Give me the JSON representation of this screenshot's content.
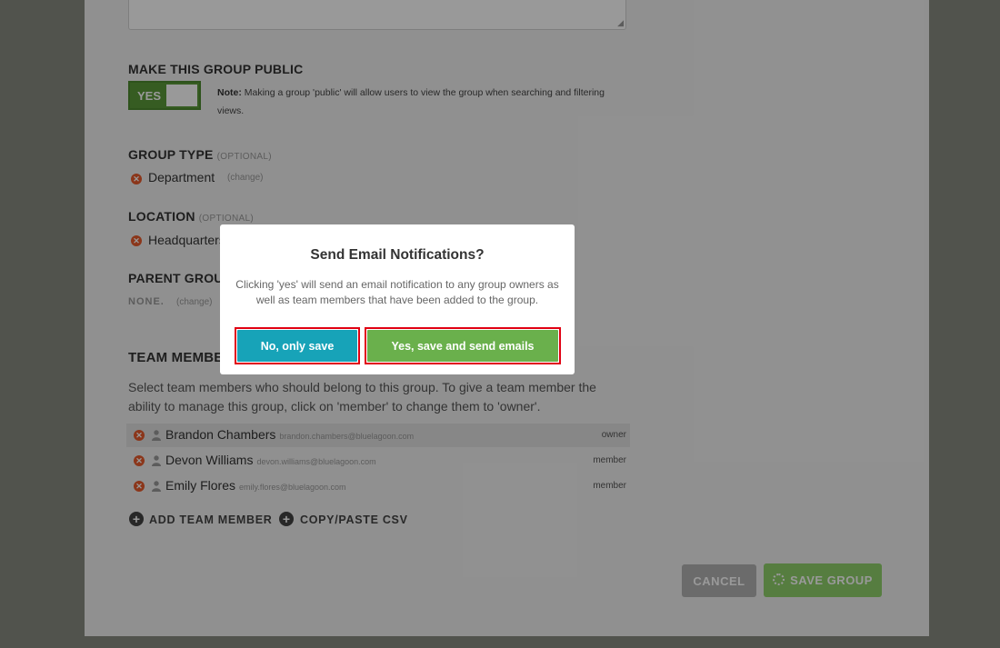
{
  "form": {
    "public": {
      "heading": "MAKE THIS GROUP PUBLIC",
      "toggle_label": "YES",
      "note_label": "Note:",
      "note_text": "Making a group 'public' will allow users to view the group when searching and filtering views."
    },
    "group_type": {
      "heading": "GROUP TYPE",
      "optional": "(OPTIONAL)",
      "value": "Department",
      "change": "(change)"
    },
    "location": {
      "heading": "LOCATION",
      "optional": "(OPTIONAL)",
      "value": "Headquarters"
    },
    "parent_group": {
      "heading": "PARENT GROUP",
      "value": "NONE.",
      "change": "(change)"
    },
    "team_members": {
      "heading": "TEAM MEMBERS",
      "description": "Select team members who should belong to this group. To give a team member the ability to manage this group, click on 'member' to change them to 'owner'.",
      "members": [
        {
          "name": "Brandon Chambers",
          "email": "brandon.chambers@bluelagoon.com",
          "role": "owner"
        },
        {
          "name": "Devon Williams",
          "email": "devon.williams@bluelagoon.com",
          "role": "member"
        },
        {
          "name": "Emily Flores",
          "email": "emily.flores@bluelagoon.com",
          "role": "member"
        }
      ],
      "add_label": "ADD TEAM MEMBER",
      "csv_label": "COPY/PASTE CSV"
    },
    "actions": {
      "cancel_label": "CANCEL",
      "save_label": "SAVE GROUP"
    }
  },
  "modal": {
    "title": "Send Email Notifications?",
    "text": "Clicking 'yes' will send an email notification to any group owners as well as team members that have been added to the group.",
    "no_label": "No, only save",
    "yes_label": "Yes, save and send emails"
  },
  "colors": {
    "accent_green": "#6ab04c",
    "accent_teal": "#17a3b8",
    "remove_orange": "#e85a2c",
    "highlight_red": "#e00012"
  }
}
